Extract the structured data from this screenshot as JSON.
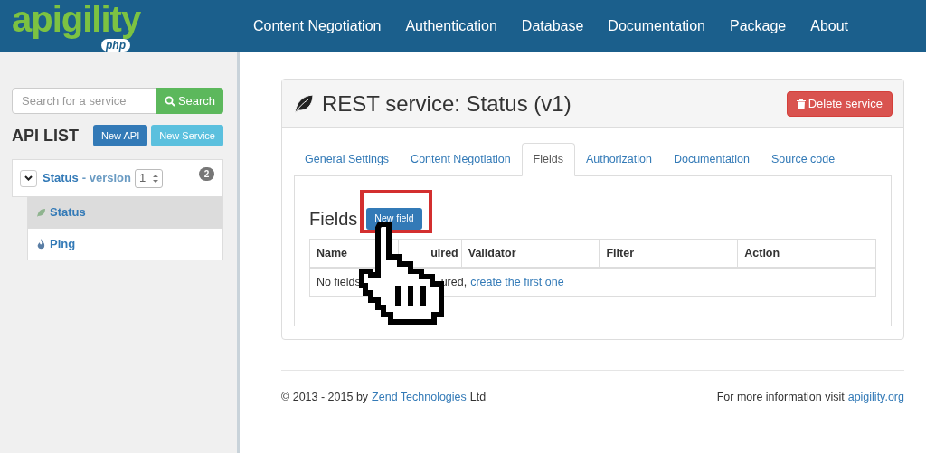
{
  "logo": {
    "word": "apigility",
    "badge": "php"
  },
  "nav": [
    "Content Negotiation",
    "Authentication",
    "Database",
    "Documentation",
    "Package",
    "About"
  ],
  "sidebar": {
    "search": {
      "placeholder": "Search for a service",
      "button": "Search"
    },
    "title": "API LIST",
    "buttons": [
      "New API",
      "New Service"
    ],
    "api": {
      "name": "Status",
      "version_label": "- version",
      "version": "1",
      "count": "2",
      "expanded": true,
      "services": [
        {
          "name": "Status",
          "kind": "rest",
          "selected": true
        },
        {
          "name": "Ping",
          "kind": "rpc",
          "selected": false
        }
      ]
    }
  },
  "panel": {
    "title": "REST service: Status (v1)",
    "delete_button": "Delete service",
    "tabs": [
      {
        "label": "General Settings",
        "selected": false
      },
      {
        "label": "Content Negotiation",
        "selected": false
      },
      {
        "label": "Fields",
        "selected": true
      },
      {
        "label": "Authorization",
        "selected": false
      },
      {
        "label": "Documentation",
        "selected": false
      },
      {
        "label": "Source code",
        "selected": false
      }
    ],
    "heading": "Fields",
    "new_button": "New field",
    "table": {
      "columns": [
        "Name",
        "uired",
        "Validator",
        "Filter",
        "Action"
      ],
      "empty_message": [
        "No fields",
        "ured,"
      ],
      "empty_link": "create the first one"
    }
  },
  "footer": {
    "copyright": "© 2013 - 2015 by",
    "company": "Zend Technologies",
    "suffix": "Ltd",
    "info": "For more information visit",
    "link": "apigility.org"
  }
}
